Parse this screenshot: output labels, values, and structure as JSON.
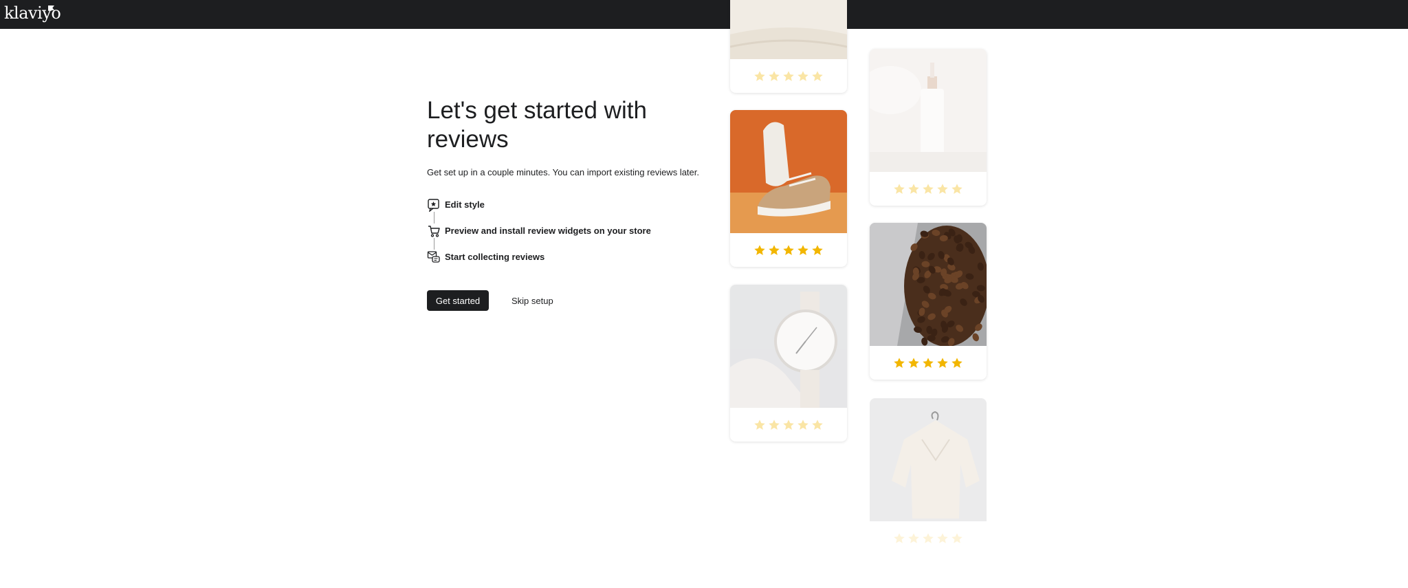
{
  "app": {
    "logo_text": "klaviyo"
  },
  "main": {
    "title": "Let's get started with reviews",
    "subtitle": "Get set up in a couple minutes. You can import existing reviews later.",
    "steps": [
      {
        "label": "Edit style",
        "icon": "star-bubble-icon"
      },
      {
        "label": "Preview and install review widgets on your store",
        "icon": "cart-icon"
      },
      {
        "label": "Start collecting reviews",
        "icon": "envelope-chat-icon"
      }
    ],
    "primary_button": "Get started",
    "secondary_button": "Skip setup"
  },
  "cards": [
    {
      "product": "towel",
      "rating": 5
    },
    {
      "product": "serum-bottle",
      "rating": 5
    },
    {
      "product": "sneaker",
      "rating": 5
    },
    {
      "product": "coffee-beans",
      "rating": 5
    },
    {
      "product": "watch",
      "rating": 5
    },
    {
      "product": "sweater",
      "rating": 5
    }
  ],
  "colors": {
    "star": "#f2b600",
    "topbar": "#1d1e20",
    "button": "#1d1e20"
  }
}
